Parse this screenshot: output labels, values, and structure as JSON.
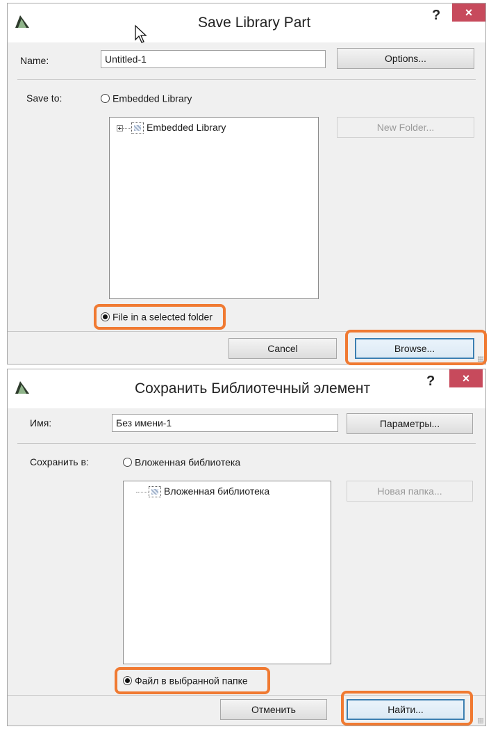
{
  "dialog_en": {
    "title": "Save Library Part",
    "help_label": "?",
    "close_label": "×",
    "name_label": "Name:",
    "name_value": "Untitled-1",
    "options_button": "Options...",
    "save_to_label": "Save to:",
    "radio_embedded": "Embedded Library",
    "tree_item": "Embedded Library",
    "new_folder_button": "New Folder...",
    "radio_file": "File in a selected folder",
    "cancel_button": "Cancel",
    "browse_button": "Browse..."
  },
  "dialog_ru": {
    "title": "Сохранить Библиотечный элемент",
    "help_label": "?",
    "close_label": "×",
    "name_label": "Имя:",
    "name_value": "Без имени-1",
    "options_button": "Параметры...",
    "save_to_label": "Сохранить в:",
    "radio_embedded": "Вложенная библиотека",
    "tree_item": "Вложенная библиотека",
    "new_folder_button": "Новая папка...",
    "radio_file": "Файл в выбранной папке",
    "cancel_button": "Отменить",
    "browse_button": "Найти..."
  },
  "colors": {
    "highlight": "#f07a32",
    "close_button": "#c74a5c",
    "default_button_border": "#3c7fb1"
  }
}
